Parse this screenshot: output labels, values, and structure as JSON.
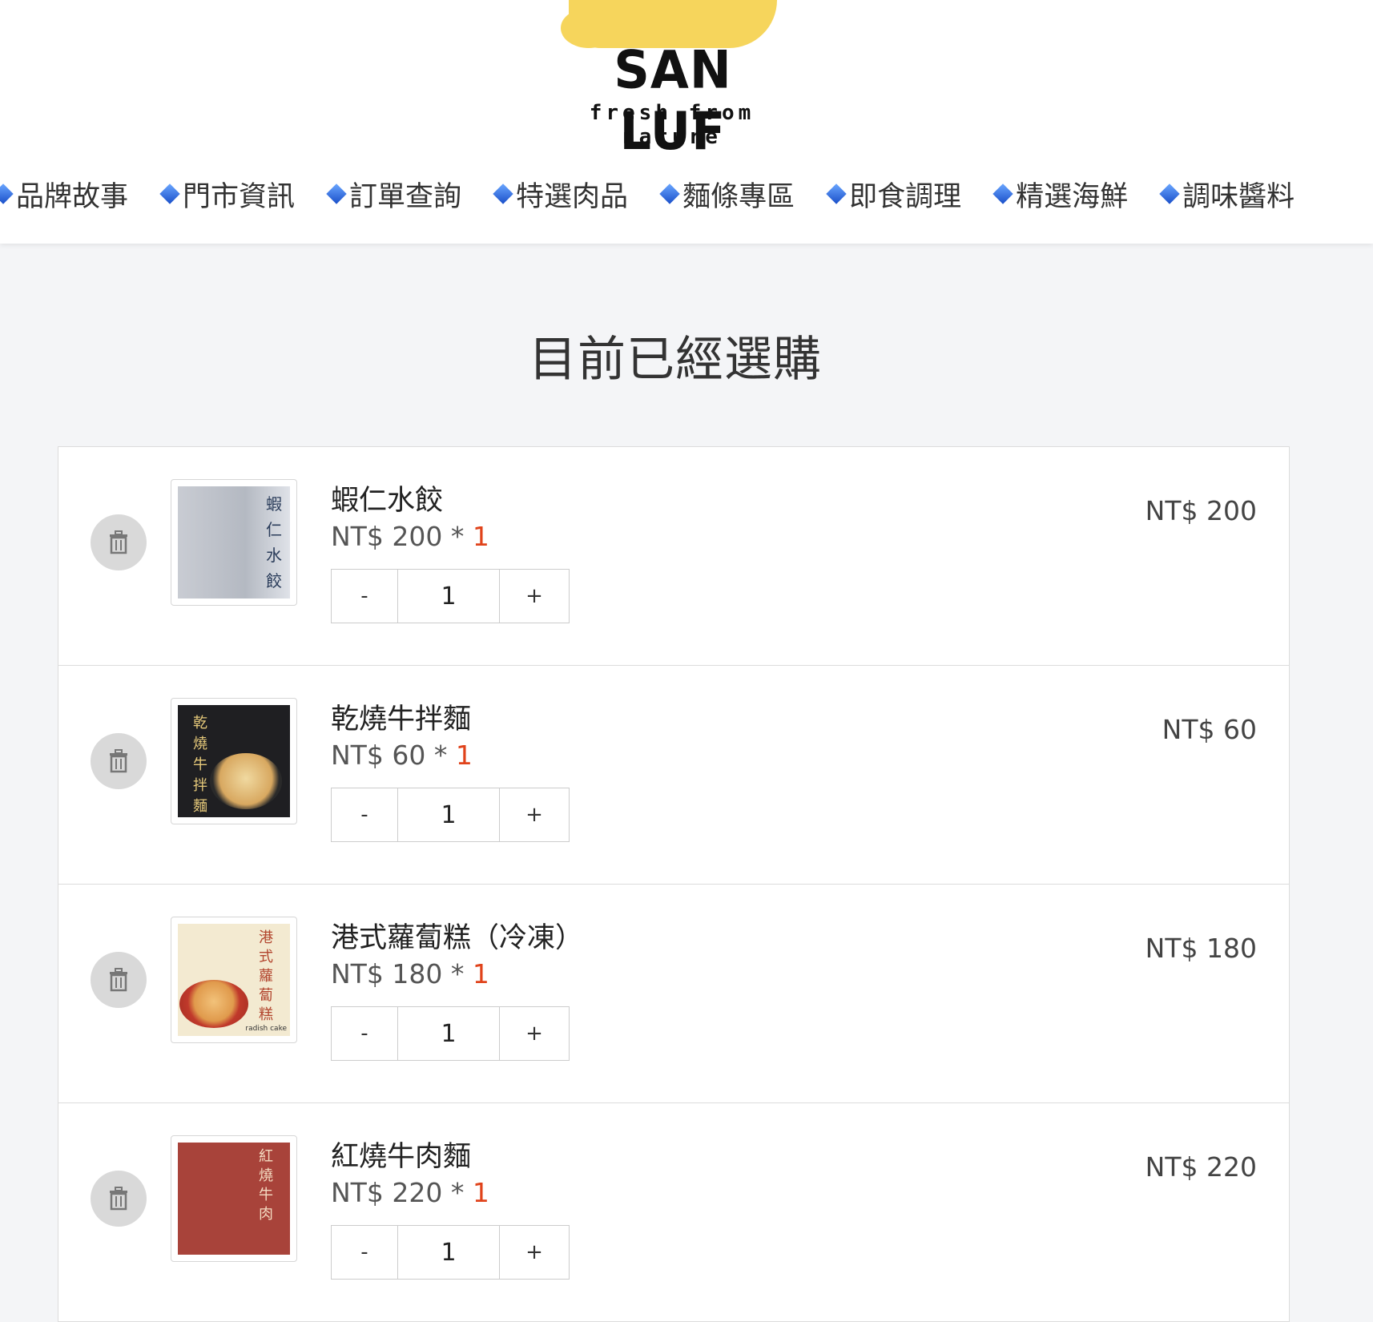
{
  "brand": {
    "name": "SAN LUF",
    "tagline": "fresh from nature"
  },
  "nav": {
    "items": [
      {
        "label": "品牌故事"
      },
      {
        "label": "門市資訊"
      },
      {
        "label": "訂單查詢"
      },
      {
        "label": "特選肉品"
      },
      {
        "label": "麵條專區"
      },
      {
        "label": "即食調理"
      },
      {
        "label": "精選海鮮"
      },
      {
        "label": "調味醬料"
      }
    ]
  },
  "page": {
    "title": "目前已經選購"
  },
  "cart": {
    "minus_label": "-",
    "plus_label": "+",
    "items": [
      {
        "name": "蝦仁水餃",
        "unit_price": "NT$ 200",
        "multiply": " * ",
        "qty": "1",
        "input_value": "1",
        "subtotal": "NT$ 200",
        "thumb_text": "蝦仁水餃",
        "thumb_sub": "",
        "thumb_bg": "#b7bcc6",
        "thumb_fg": "#2a3c5a"
      },
      {
        "name": "乾燒牛拌麵",
        "unit_price": "NT$ 60",
        "multiply": " * ",
        "qty": "1",
        "input_value": "1",
        "subtotal": "NT$ 60",
        "thumb_text": "乾燒牛拌麵",
        "thumb_sub": "",
        "thumb_bg": "#1f1f22",
        "thumb_fg": "#e6c97a"
      },
      {
        "name": "港式蘿蔔糕（冷凍）",
        "unit_price": "NT$ 180",
        "multiply": " * ",
        "qty": "1",
        "input_value": "1",
        "subtotal": "NT$ 180",
        "thumb_text": "港式蘿蔔糕",
        "thumb_sub": "radish cake",
        "thumb_bg": "#f3ead1",
        "thumb_fg": "#b2452e"
      },
      {
        "name": "紅燒牛肉麵",
        "unit_price": "NT$ 220",
        "multiply": " * ",
        "qty": "1",
        "input_value": "1",
        "subtotal": "NT$ 220",
        "thumb_text": "紅燒牛肉",
        "thumb_sub": "",
        "thumb_bg": "#a8433a",
        "thumb_fg": "#f4dcc2"
      }
    ]
  },
  "icons": {
    "delete": "trash-icon",
    "nav_bullet": "diamond-icon"
  },
  "colors": {
    "qty_accent": "#e0431b",
    "logo_yellow": "#f6d55c"
  }
}
